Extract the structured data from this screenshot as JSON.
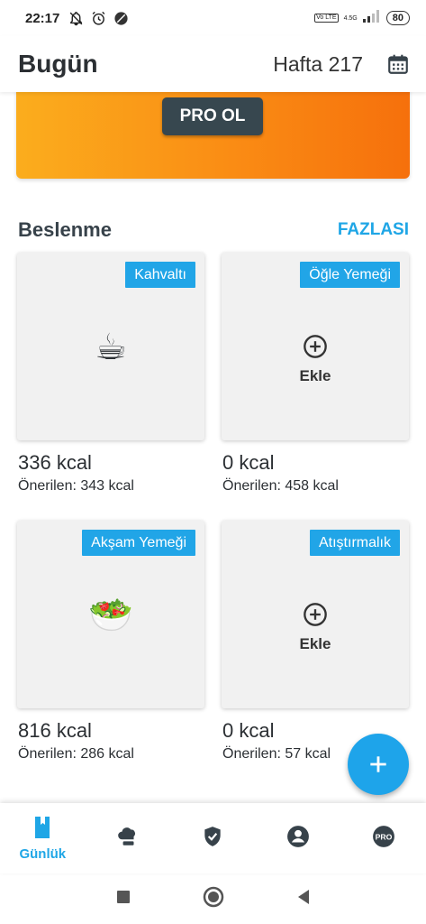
{
  "status_bar": {
    "time": "22:17",
    "network": "4.5G",
    "volte": "Vo LTE",
    "battery": "80"
  },
  "header": {
    "title": "Bugün",
    "week": "Hafta 217",
    "calendar_icon": "calendar-icon"
  },
  "promo": {
    "button_label": "PRO OL"
  },
  "nutrition": {
    "title": "Beslenme",
    "more": "FAZLASI",
    "meals": [
      {
        "tag": "Kahvaltı",
        "emoji": "☕",
        "kcal": "336 kcal",
        "recommended": "Önerilen: 343 kcal"
      },
      {
        "tag": "Öğle Yemeği",
        "add_label": "Ekle",
        "kcal": "0 kcal",
        "recommended": "Önerilen: 458 kcal"
      },
      {
        "tag": "Akşam Yemeği",
        "emoji": "🥗",
        "kcal": "816 kcal",
        "recommended": "Önerilen: 286 kcal"
      },
      {
        "tag": "Atıştırmalık",
        "add_label": "Ekle",
        "kcal": "0 kcal",
        "recommended": "Önerilen: 57 kcal"
      }
    ]
  },
  "bottom_nav": {
    "items": [
      {
        "icon": "journal-icon",
        "label": "Günlük",
        "active": true
      },
      {
        "icon": "chef-hat-icon"
      },
      {
        "icon": "shield-check-icon"
      },
      {
        "icon": "account-icon"
      },
      {
        "icon": "pro-badge-icon",
        "text": "PRO"
      }
    ]
  },
  "colors": {
    "accent": "#1fa6e6",
    "promo_start": "#fbad1d",
    "promo_end": "#f6700c",
    "pro_button": "#37474f"
  }
}
